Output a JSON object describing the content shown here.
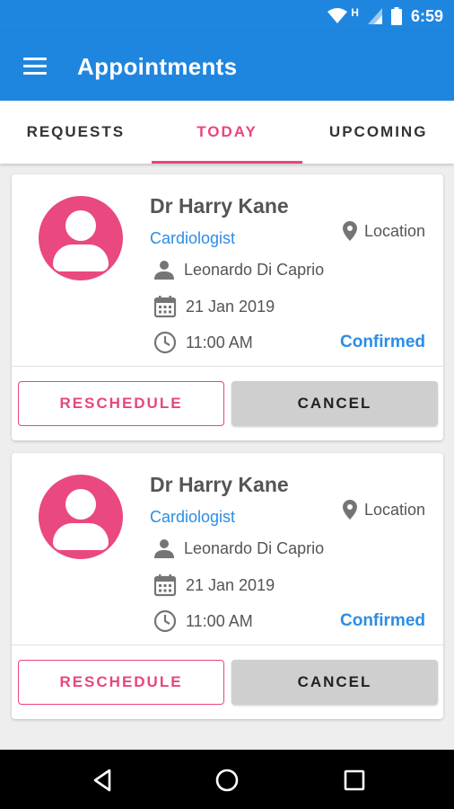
{
  "status_bar": {
    "time": "6:59",
    "network_label": "H"
  },
  "app_bar": {
    "title": "Appointments"
  },
  "tabs": [
    {
      "label": "REQUESTS",
      "active": false
    },
    {
      "label": "TODAY",
      "active": true
    },
    {
      "label": "UPCOMING",
      "active": false
    }
  ],
  "appointments": [
    {
      "doctor": "Dr Harry Kane",
      "specialty": "Cardiologist",
      "location_label": "Location",
      "patient": "Leonardo Di Caprio",
      "date": "21 Jan 2019",
      "time": "11:00 AM",
      "status": "Confirmed",
      "reschedule_label": "RESCHEDULE",
      "cancel_label": "CANCEL"
    },
    {
      "doctor": "Dr Harry Kane",
      "specialty": "Cardiologist",
      "location_label": "Location",
      "patient": "Leonardo Di Caprio",
      "date": "21 Jan 2019",
      "time": "11:00 AM",
      "status": "Confirmed",
      "reschedule_label": "RESCHEDULE",
      "cancel_label": "CANCEL"
    }
  ],
  "colors": {
    "primary": "#1f86e0",
    "accent": "#e8467c",
    "status_confirmed": "#2b8de6"
  },
  "icons": [
    "wifi-icon",
    "signal-icon",
    "battery-icon",
    "menu-icon",
    "location-pin-icon",
    "person-icon",
    "calendar-icon",
    "clock-icon",
    "back-icon",
    "home-icon",
    "recents-icon"
  ]
}
